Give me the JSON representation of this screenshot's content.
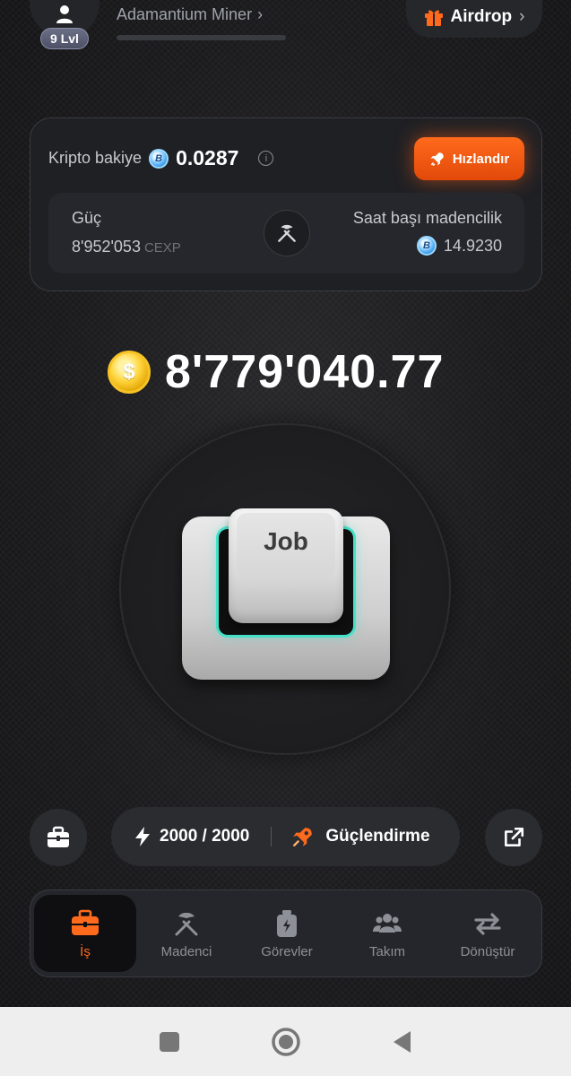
{
  "header": {
    "level": "9 Lvl",
    "rank": "Adamantium Miner",
    "rank_progress": 0,
    "airdrop": "Airdrop"
  },
  "card": {
    "crypto_label": "Kripto bakiye",
    "crypto_value": "0.0287",
    "boost_label": "Hızlandır",
    "power_label": "Güç",
    "power_value": "8'952'053",
    "power_unit": "CEXP",
    "hourly_label": "Saat başı madencilik",
    "hourly_value": "14.9230"
  },
  "main": {
    "balance": "8'779'040.77",
    "key_label": "Job"
  },
  "actions": {
    "energy": "2000 / 2000",
    "boost": "Güçlendirme"
  },
  "nav": {
    "items": [
      {
        "label": "İş",
        "icon": "briefcase-icon",
        "active": true
      },
      {
        "label": "Madenci",
        "icon": "pickaxe-icon",
        "active": false
      },
      {
        "label": "Görevler",
        "icon": "tasks-icon",
        "active": false
      },
      {
        "label": "Takım",
        "icon": "team-icon",
        "active": false
      },
      {
        "label": "Dönüştür",
        "icon": "convert-icon",
        "active": false
      }
    ]
  },
  "colors": {
    "accent": "#ff6a1c",
    "background": "#1b1b1d",
    "glow": "#47e0c8"
  }
}
